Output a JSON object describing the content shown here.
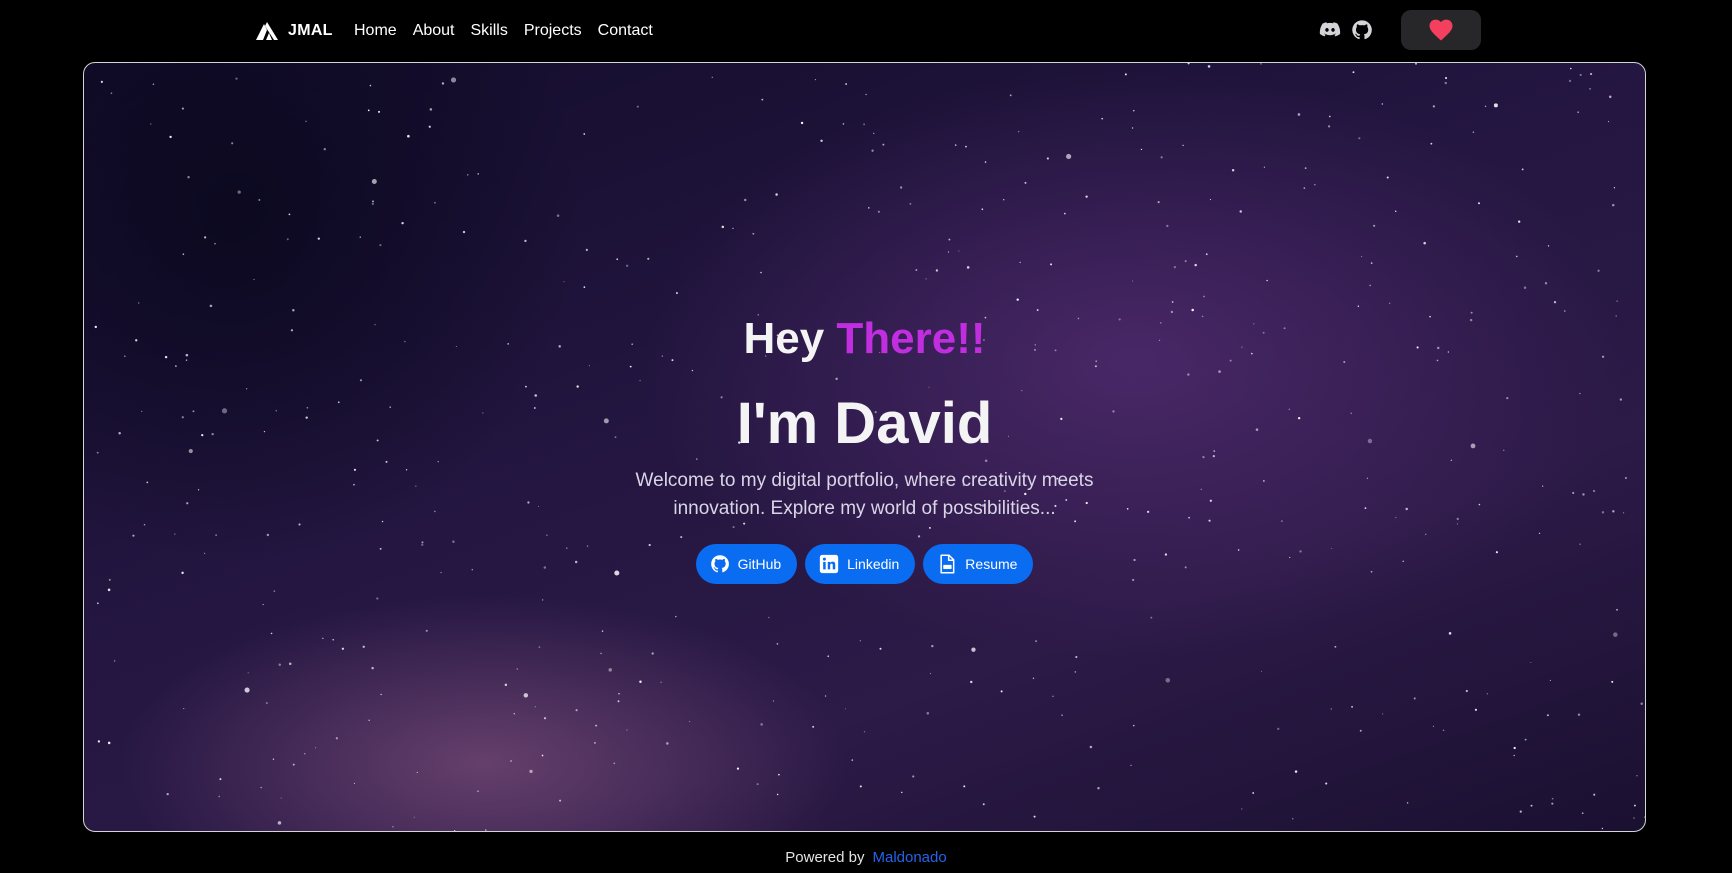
{
  "nav": {
    "brand_name": "JMAL",
    "links": [
      "Home",
      "About",
      "Skills",
      "Projects",
      "Contact"
    ],
    "icons": [
      "discord-icon",
      "github-icon"
    ],
    "sponsor_icon": "heart-icon",
    "sponsor_color": "#f43f5e"
  },
  "hero": {
    "greeting_prefix": "Hey",
    "greeting_accent": "There!!",
    "name_line": "I'm David",
    "description": "Welcome to my digital portfolio, where creativity meets innovation. Explore my world of possibilities...",
    "buttons": [
      {
        "label": "GitHub",
        "icon": "github-icon"
      },
      {
        "label": "Linkedin",
        "icon": "linkedin-icon"
      },
      {
        "label": "Resume",
        "icon": "pdf-file-icon"
      }
    ],
    "accent_color": "#c02ee0",
    "button_color": "#0a6cf0"
  },
  "footer": {
    "text": "Powered by",
    "link_text": "Maldonado"
  }
}
